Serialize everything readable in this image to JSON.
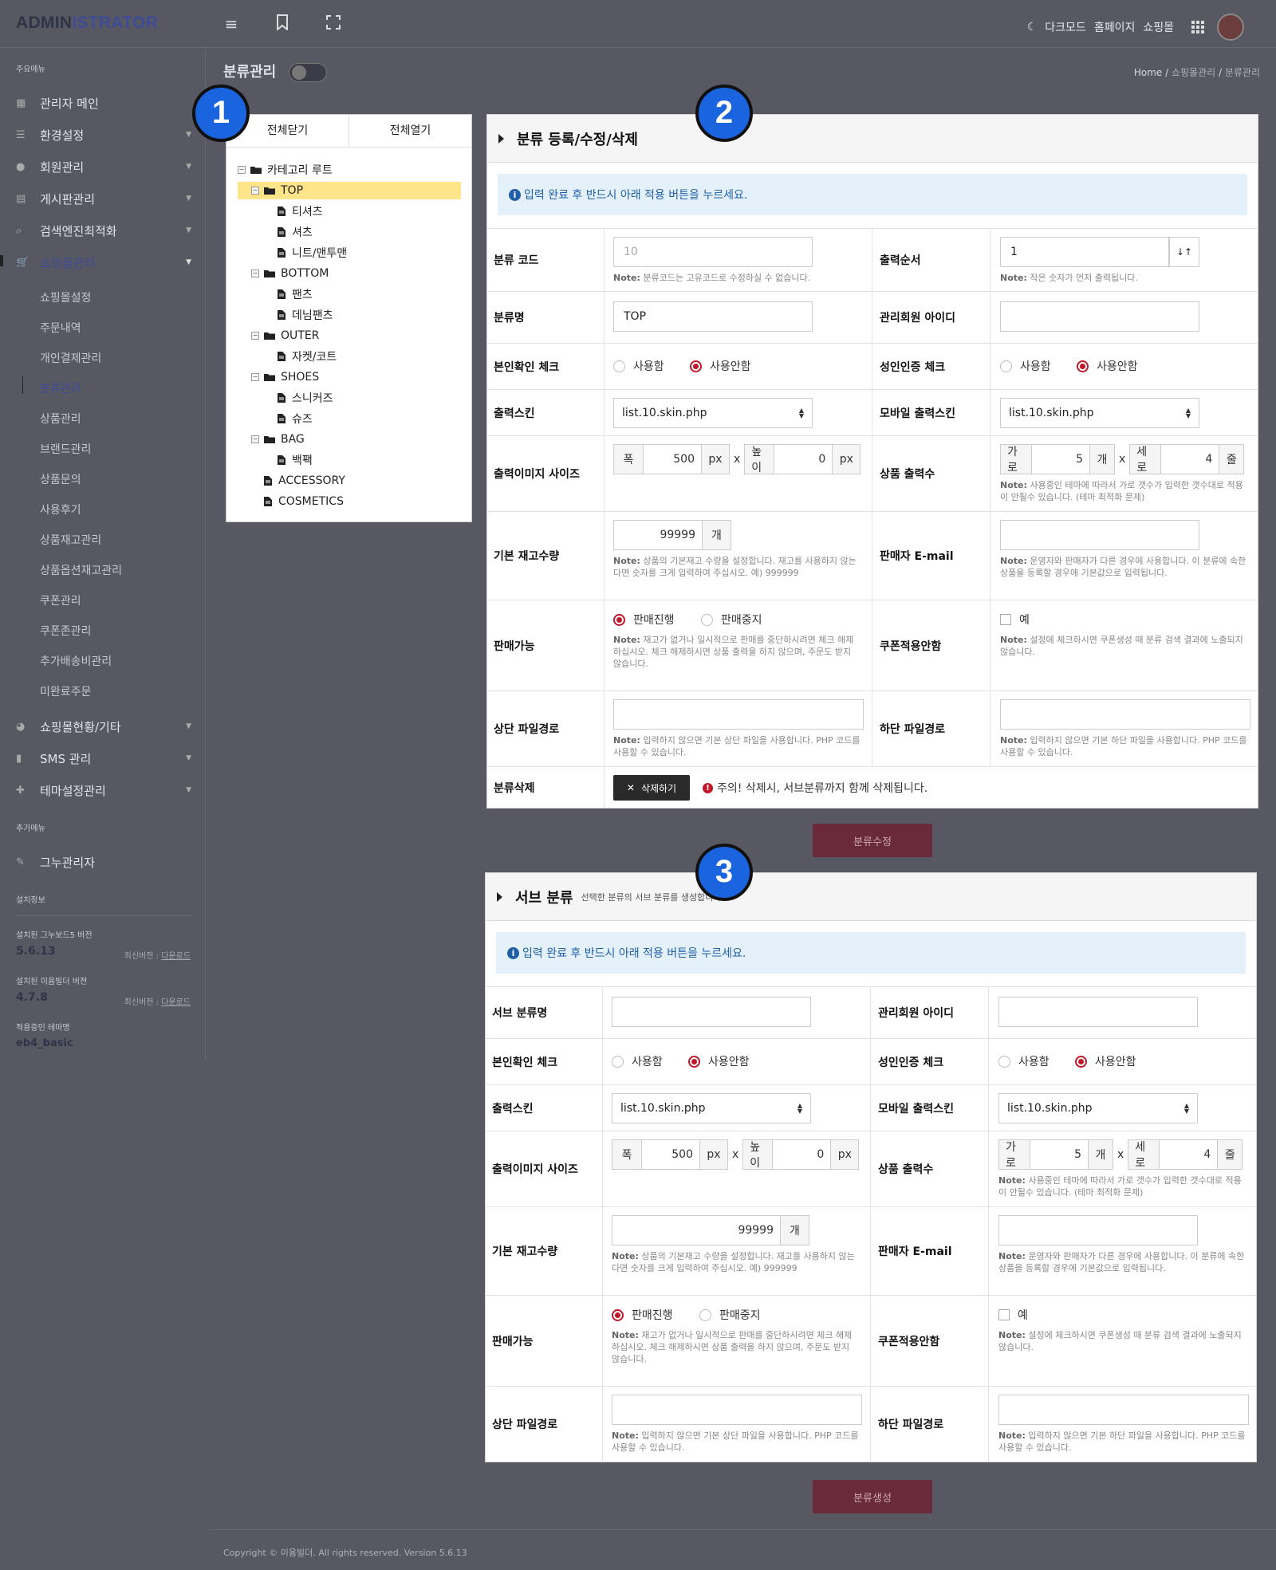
{
  "topbar": {
    "logo_a": "ADMIN",
    "logo_b": "ISTRATOR",
    "dark_mode": "다크모드",
    "home": "홈페이지",
    "shop": "쇼핑몰"
  },
  "sidebar": {
    "section_main": "주요메뉴",
    "items": [
      {
        "label": "관리자 메인",
        "icon": "dashboard-icon"
      },
      {
        "label": "환경설정",
        "icon": "list-icon"
      },
      {
        "label": "회원관리",
        "icon": "user-icon"
      },
      {
        "label": "게시판관리",
        "icon": "board-icon"
      },
      {
        "label": "검색엔진최적화",
        "icon": "search-icon"
      },
      {
        "label": "쇼핑몰관리",
        "icon": "cart-icon"
      }
    ],
    "subitems": [
      "쇼핑몰설정",
      "주문내역",
      "개인결제관리",
      "분류관리",
      "상품관리",
      "브랜드관리",
      "상품문의",
      "사용후기",
      "상품재고관리",
      "상품옵션재고관리",
      "쿠폰관리",
      "쿠폰존관리",
      "추가배송비관리",
      "미완료주문"
    ],
    "items2": [
      {
        "label": "쇼핑몰현황/기타",
        "icon": "chart-icon"
      },
      {
        "label": "SMS 관리",
        "icon": "phone-icon"
      },
      {
        "label": "테마설정관리",
        "icon": "puzzle-icon"
      }
    ],
    "section_extra": "추가메뉴",
    "gnu_admin": "그누관리자",
    "section_info": "설치정보",
    "gnuboard_label": "설치된 그누보드5 버전",
    "gnuboard_ver": "5.6.13",
    "latest_label": "최신버전 : ",
    "download": "다운로드",
    "eyoom_label": "설치된 이윰빌더 버전",
    "eyoom_ver": "4.7.8",
    "theme_label": "적용중인 테마명",
    "theme_name": "eb4_basic"
  },
  "page": {
    "title": "분류관리",
    "breadcrumb": [
      "Home",
      "쇼핑몰관리",
      "분류관리"
    ]
  },
  "badges": [
    "1",
    "2",
    "3"
  ],
  "tree": {
    "collapse_all": "전체닫기",
    "expand_all": "전체열기",
    "root": "카테고리 루트",
    "nodes": [
      {
        "label": "TOP",
        "level": 1,
        "type": "folder"
      },
      {
        "label": "티셔츠",
        "level": 2,
        "type": "file"
      },
      {
        "label": "셔츠",
        "level": 2,
        "type": "file"
      },
      {
        "label": "니트/맨투맨",
        "level": 2,
        "type": "file"
      },
      {
        "label": "BOTTOM",
        "level": 1,
        "type": "folder"
      },
      {
        "label": "팬츠",
        "level": 2,
        "type": "file"
      },
      {
        "label": "데님팬츠",
        "level": 2,
        "type": "file"
      },
      {
        "label": "OUTER",
        "level": 1,
        "type": "folder"
      },
      {
        "label": "자켓/코트",
        "level": 2,
        "type": "file"
      },
      {
        "label": "SHOES",
        "level": 1,
        "type": "folder"
      },
      {
        "label": "스니커즈",
        "level": 2,
        "type": "file"
      },
      {
        "label": "슈즈",
        "level": 2,
        "type": "file"
      },
      {
        "label": "BAG",
        "level": 1,
        "type": "folder"
      },
      {
        "label": "백팩",
        "level": 2,
        "type": "file"
      },
      {
        "label": "ACCESSORY",
        "level": 1,
        "type": "file"
      },
      {
        "label": "COSMETICS",
        "level": 1,
        "type": "file"
      }
    ]
  },
  "common": {
    "alert": "입력 완료 후 반드시 아래 적용 버튼을 누르세요.",
    "note": "Note:",
    "use": "사용함",
    "not_use": "사용안함",
    "skin": "list.10.skin.php",
    "width": "폭",
    "height": "높이",
    "px": "px",
    "x": "x",
    "img_w": "500",
    "img_h": "0",
    "horizontal": "가로",
    "vertical": "세로",
    "unit_ea": "개",
    "unit_row": "줄",
    "cols": "5",
    "rows": "4",
    "stock": "99999",
    "sale_on": "판매진행",
    "sale_off": "판매중지",
    "yes": "예",
    "lbl_name": "분류명",
    "lbl_sub_name": "서브 분류명",
    "lbl_admin_id": "관리회원 아이디",
    "lbl_cert": "본인확인 체크",
    "lbl_adult": "성인인증 체크",
    "lbl_skin": "출력스킨",
    "lbl_mskin": "모바일 출력스킨",
    "lbl_imgsize": "출력이미지 사이즈",
    "lbl_listcount": "상품 출력수",
    "lbl_stock": "기본 재고수량",
    "lbl_email": "판매자 E-mail",
    "lbl_sale": "판매가능",
    "lbl_coupon": "쿠폰적용안함",
    "lbl_head": "상단 파일경로",
    "lbl_tail": "하단 파일경로",
    "note_listcount": "사용중인 테마에 따라서 가로 갯수가 입력한 갯수대로 적용이 안될수 있습니다. (테마 최적화 문제)",
    "note_stock": "상품의 기본재고 수량을 설정합니다. 재고를 사용하지 않는다면 숫자를 크게 입력하여 주십시오. 예) 999999",
    "note_email": "운영자와 판매자가 다른 경우에 사용합니다. 이 분류에 속한 상품을 등록할 경우에 기본값으로 입력됩니다.",
    "note_sale": "재고가 없거나 일시적으로 판매를 중단하시려면 체크 해제하십시오. 체크 해제하시면 상품 출력을 하지 않으며, 주문도 받지 않습니다.",
    "note_coupon": "설정에 체크하시면 쿠폰생성 때 분류 검색 결과에 노출되지 않습니다.",
    "note_head": "입력하지 않으면 기본 상단 파일을 사용합니다. PHP 코드를 사용할 수 있습니다.",
    "note_tail": "입력하지 않으면 기본 하단 파일을 사용합니다. PHP 코드를 사용할 수 있습니다."
  },
  "form1": {
    "title": "분류 등록/수정/삭제",
    "lbl_code": "분류 코드",
    "code_value": "10",
    "note_code": "분류코드는 고유코드로 수정하실 수 없습니다.",
    "lbl_order": "출력순서",
    "order_value": "1",
    "note_order": "작은 숫자가 먼저 출력됩니다.",
    "name_value": "TOP",
    "lbl_delete": "분류삭제",
    "delete_btn": "삭제하기",
    "delete_warn": "주의! 삭제시, 서브분류까지 함께 삭제됩니다.",
    "submit": "분류수정"
  },
  "form2": {
    "title": "서브 분류",
    "subtitle": "선택한 분류의 서브 분류를 생성합니다.",
    "submit": "분류생성"
  },
  "footer": "Copyright © 이윰빌더. All rights reserved. Version 5.6.13"
}
